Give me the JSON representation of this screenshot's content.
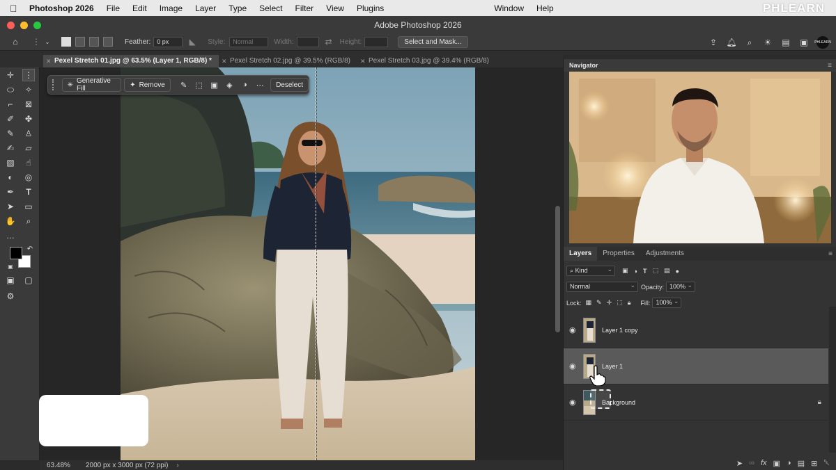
{
  "menubar": {
    "app_name": "Photoshop 2026",
    "items": [
      "File",
      "Edit",
      "Image",
      "Layer",
      "Type",
      "Select",
      "Filter",
      "View",
      "Plugins",
      "Window",
      "Help"
    ],
    "brand_overlay": "PHLEARN"
  },
  "window": {
    "title": "Adobe Photoshop 2026"
  },
  "options": {
    "feather_label": "Feather:",
    "feather_value": "0 px",
    "style_label": "Style:",
    "style_value": "Normal",
    "width_label": "Width:",
    "height_label": "Height:",
    "select_mask_label": "Select and Mask..."
  },
  "tabs": [
    {
      "label": "Pexel Stretch 01.jpg @ 63.5% (Layer 1, RGB/8) *",
      "active": true
    },
    {
      "label": "Pexel Stretch 02.jpg @ 39.5% (RGB/8)",
      "active": false
    },
    {
      "label": "Pexel Stretch 03.jpg @ 39.4% (RGB/8)",
      "active": false
    }
  ],
  "contextbar": {
    "generative_fill_label": "Generative Fill",
    "remove_label": "Remove",
    "deselect_label": "Deselect"
  },
  "colors": {
    "foreground": "#000000",
    "background": "#ffffff",
    "accent_app": "#31a8ff"
  },
  "status": {
    "zoom": "63.48%",
    "doc_info": "2000 px x 3000 px (72 ppi)"
  },
  "navigator": {
    "title": "Navigator"
  },
  "layers_panel": {
    "tabs": [
      "Layers",
      "Properties",
      "Adjustments"
    ],
    "filter_kind": "Kind",
    "blend_mode": "Normal",
    "opacity_label": "Opacity:",
    "opacity_value": "100%",
    "lock_label": "Lock:",
    "fill_label": "Fill:",
    "fill_value": "100%",
    "layers": [
      {
        "name": "Layer 1 copy",
        "visible": true,
        "selected": false,
        "locked": false
      },
      {
        "name": "Layer 1",
        "visible": true,
        "selected": true,
        "locked": false
      },
      {
        "name": "Background",
        "visible": true,
        "selected": false,
        "locked": true
      }
    ]
  }
}
